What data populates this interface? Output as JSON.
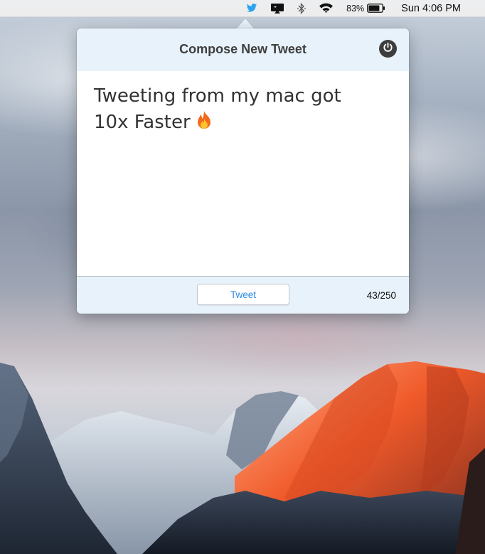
{
  "menubar": {
    "icons": [
      "twitter-bird-icon",
      "airplay-display-icon",
      "bluetooth-icon",
      "wifi-icon",
      "battery-icon"
    ],
    "battery_percent": "83%",
    "battery_level": 0.83,
    "clock": "Sun 4:06 PM"
  },
  "popover": {
    "title": "Compose New Tweet",
    "power_icon": "power-icon",
    "tweet_text": "Tweeting from my mac got\n10x Faster",
    "emoji": "fire",
    "tweet_button_label": "Tweet",
    "char_count": "43/250"
  },
  "colors": {
    "header_bg": "#e8f2fa",
    "tweet_button_text": "#2a8be0",
    "twitter_blue": "#2aa3ef"
  }
}
